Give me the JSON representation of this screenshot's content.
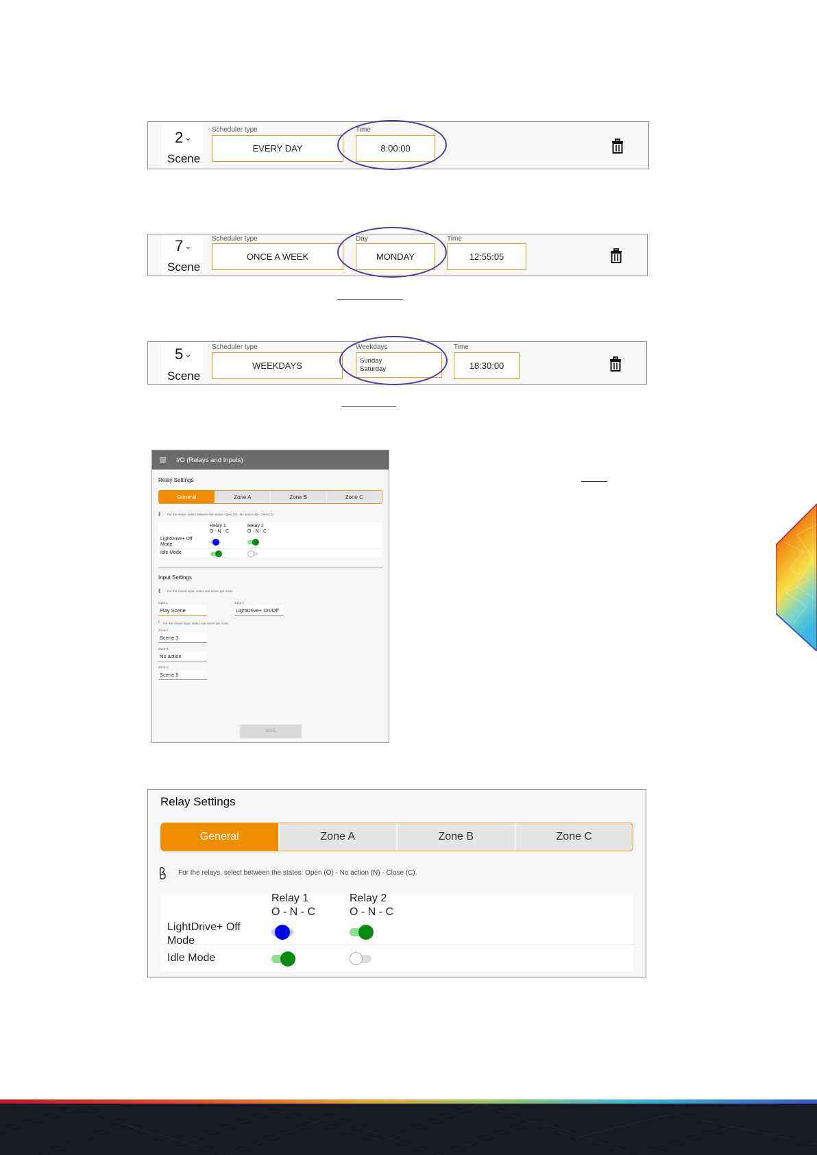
{
  "schedulers": [
    {
      "number": "2",
      "mode": "Scene",
      "type_label": "Scheduler type",
      "type_value": "EVERY DAY",
      "fields": [
        {
          "label": "Time",
          "value": "8:00:00"
        }
      ]
    },
    {
      "number": "7",
      "mode": "Scene",
      "type_label": "Scheduler type",
      "type_value": "ONCE A WEEK",
      "fields": [
        {
          "label": "Day",
          "value": "MONDAY"
        },
        {
          "label": "Time",
          "value": "12:55:05"
        }
      ]
    },
    {
      "number": "5",
      "mode": "Scene",
      "type_label": "Scheduler type",
      "type_value": "WEEKDAYS",
      "weekdays_label": "Weekdays",
      "weekdays": [
        "Sunday",
        "Saturday"
      ],
      "time_label": "Time",
      "time_value": "18:30:00"
    }
  ],
  "mini_screen": {
    "menu_icon": "menu-icon",
    "header_title": "I/O (Relays and Inputs)",
    "relay_settings_title": "Relay Settings",
    "tabs": [
      "General",
      "Zone A",
      "Zone B",
      "Zone C"
    ],
    "active_tab": "General",
    "relay_info": "For the relays, select between the states: Open (O) - No action (N) - Close (C).",
    "relay1_header": "Relay 1",
    "relay2_header": "Relay 2",
    "state_legend": "O - N - C",
    "row1_label": "LightDrive+ Off Mode",
    "row2_label": "Idle Mode",
    "input_settings_title": "Input Settings",
    "input_info": "For the closed input, select one action per zone.",
    "input1_label": "Input 1",
    "input1_value": "Play Scene",
    "input2_label": "Input 2",
    "input2_value": "LightDrive+ On/Off",
    "scene_info": "For the closed input, select one scene per zone.",
    "zone_a_label": "Zone A",
    "zone_a_value": "Scene 3",
    "zone_b_label": "Zone B",
    "zone_b_value": "No action",
    "zone_c_label": "Zone C",
    "zone_c_value": "Scene 5",
    "save_label": "SAVE"
  },
  "relay_panel": {
    "title": "Relay Settings",
    "tabs": [
      "General",
      "Zone A",
      "Zone B",
      "Zone C"
    ],
    "active_tab": "General",
    "info": "For the relays, select between the states: Open (O) - No action (N) - Close (C).",
    "relay1_header": "Relay 1",
    "relay2_header": "Relay 2",
    "state_legend": "O - N - C",
    "row1_label": "LightDrive+ Off Mode",
    "row2_label": "Idle Mode",
    "states": {
      "off_mode_relay1": "N",
      "off_mode_relay2": "C",
      "idle_relay1": "C",
      "idle_relay2": "O"
    }
  },
  "colors": {
    "accent_orange": "#ef8c00",
    "field_border": "#e49a1a",
    "highlight_ellipse": "#4a3aa3",
    "toggle_blue": "#0000ee",
    "toggle_green": "#0a8a12",
    "header_grey": "#6b6b6b"
  }
}
